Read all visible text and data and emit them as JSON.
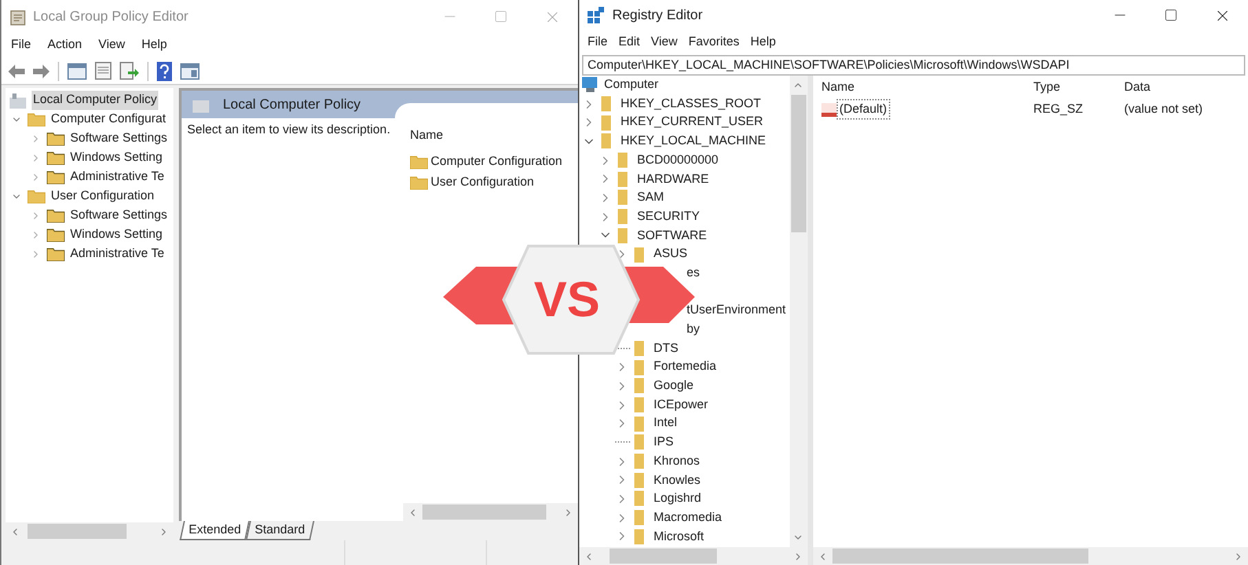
{
  "gpedit": {
    "title": "Local Group Policy Editor",
    "menu": [
      "File",
      "Action",
      "View",
      "Help"
    ],
    "tree": [
      {
        "label": "Local Computer Policy",
        "selected": true,
        "children": [
          {
            "label": "Computer Configurat",
            "selected": false,
            "expanded": true,
            "children": [
              {
                "label": "Software Settings",
                "selected": false,
                "expanded": false
              },
              {
                "label": "Windows Setting",
                "selected": false,
                "expanded": false
              },
              {
                "label": "Administrative Te",
                "selected": false,
                "expanded": false
              }
            ]
          },
          {
            "label": "User Configuration",
            "selected": false,
            "expanded": true,
            "children": [
              {
                "label": "Software Settings",
                "selected": false,
                "expanded": false
              },
              {
                "label": "Windows Setting",
                "selected": false,
                "expanded": false
              },
              {
                "label": "Administrative Te",
                "selected": false,
                "expanded": false
              }
            ]
          }
        ]
      }
    ],
    "header": "Local Computer Policy",
    "description": "Select an item to view its description.",
    "name_column": "Name",
    "items": [
      "Computer Configuration",
      "User Configuration"
    ],
    "tabs": [
      {
        "label": "Extended",
        "selected": true
      },
      {
        "label": "Standard",
        "selected": false
      }
    ]
  },
  "badge": "VS",
  "regedit": {
    "title": "Registry Editor",
    "menu": [
      "File",
      "Edit",
      "View",
      "Favorites",
      "Help"
    ],
    "address": "Computer\\HKEY_LOCAL_MACHINE\\SOFTWARE\\Policies\\Microsoft\\Windows\\WSDAPI",
    "tree": [
      {
        "label": "Computer",
        "kind": "root",
        "children": [
          {
            "label": "HKEY_CLASSES_ROOT",
            "kind": "branch",
            "expanded": false
          },
          {
            "label": "HKEY_CURRENT_USER",
            "kind": "branch",
            "expanded": false
          },
          {
            "label": "HKEY_LOCAL_MACHINE",
            "kind": "branch",
            "expanded": true,
            "children": [
              {
                "label": "BCD00000000",
                "kind": "branch",
                "expanded": false
              },
              {
                "label": "HARDWARE",
                "kind": "branch",
                "expanded": false
              },
              {
                "label": "SAM",
                "kind": "branch",
                "expanded": false
              },
              {
                "label": "SECURITY",
                "kind": "branch",
                "expanded": false
              },
              {
                "label": "SOFTWARE",
                "kind": "branch",
                "expanded": true,
                "children": [
                  {
                    "label": "ASUS",
                    "kind": "branch",
                    "expanded": false
                  },
                  {
                    "label": "es",
                    "kind": "partial",
                    "covered_row_after": true
                  },
                  {
                    "label": "tUserEnvironment",
                    "kind": "partial"
                  },
                  {
                    "label": "by",
                    "kind": "partial"
                  },
                  {
                    "label": "DTS",
                    "kind": "leaf"
                  },
                  {
                    "label": "Fortemedia",
                    "kind": "branch",
                    "expanded": false
                  },
                  {
                    "label": "Google",
                    "kind": "branch",
                    "expanded": false
                  },
                  {
                    "label": "ICEpower",
                    "kind": "branch",
                    "expanded": false
                  },
                  {
                    "label": "Intel",
                    "kind": "branch",
                    "expanded": false
                  },
                  {
                    "label": "IPS",
                    "kind": "leaf"
                  },
                  {
                    "label": "Khronos",
                    "kind": "branch",
                    "expanded": false
                  },
                  {
                    "label": "Knowles",
                    "kind": "branch",
                    "expanded": false
                  },
                  {
                    "label": "Logishrd",
                    "kind": "branch",
                    "expanded": false
                  },
                  {
                    "label": "Macromedia",
                    "kind": "branch",
                    "expanded": false
                  },
                  {
                    "label": "Microsoft",
                    "kind": "branch",
                    "expanded": false
                  }
                ]
              }
            ]
          }
        ]
      }
    ],
    "columns": [
      "Name",
      "Type",
      "Data"
    ],
    "values": [
      {
        "name": "(Default)",
        "type": "REG_SZ",
        "data": "(value not set)"
      }
    ]
  }
}
